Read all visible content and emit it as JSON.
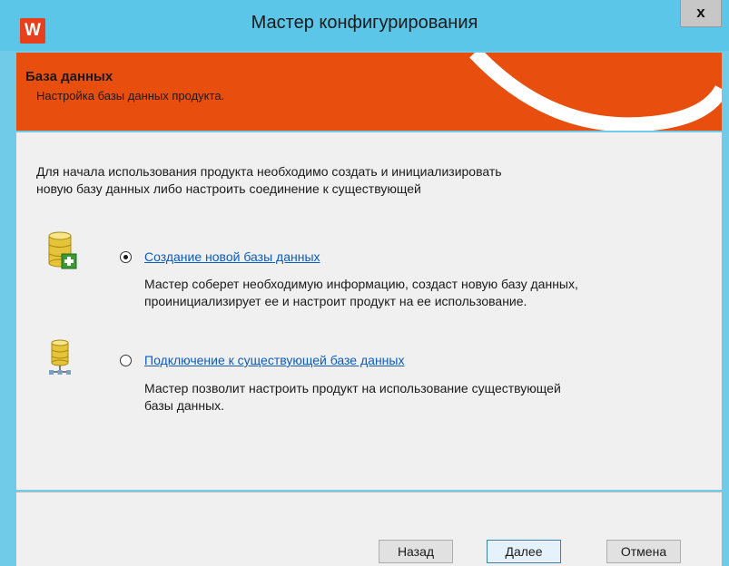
{
  "window": {
    "app_icon_letter": "W",
    "title": "Мастер конфигурирования",
    "close_label": "x"
  },
  "banner": {
    "title": "База данных",
    "subtitle": "Настройка базы данных продукта."
  },
  "intro": {
    "line1": "Для начала использования продукта необходимо создать и инициализировать",
    "line2": "новую базу данных либо настроить соединение к существующей"
  },
  "options": [
    {
      "label": "Создание новой базы данных",
      "selected": true,
      "icon": "database-add-icon",
      "desc_line1": "Мастер соберет необходимую информацию, создаст новую базу данных,",
      "desc_line2": "проинициализирует ее и настроит продукт на ее использование."
    },
    {
      "label": "Подключение к существующей базе данных",
      "selected": false,
      "icon": "database-network-icon",
      "desc_line1": "Мастер позволит настроить продукт на использование существующей",
      "desc_line2": "базы данных."
    }
  ],
  "buttons": {
    "back": "Назад",
    "next": "Далее",
    "cancel": "Отмена"
  },
  "colors": {
    "titlebar": "#5bc6e8",
    "banner": "#e84f0e",
    "link": "#0b5bc0"
  }
}
